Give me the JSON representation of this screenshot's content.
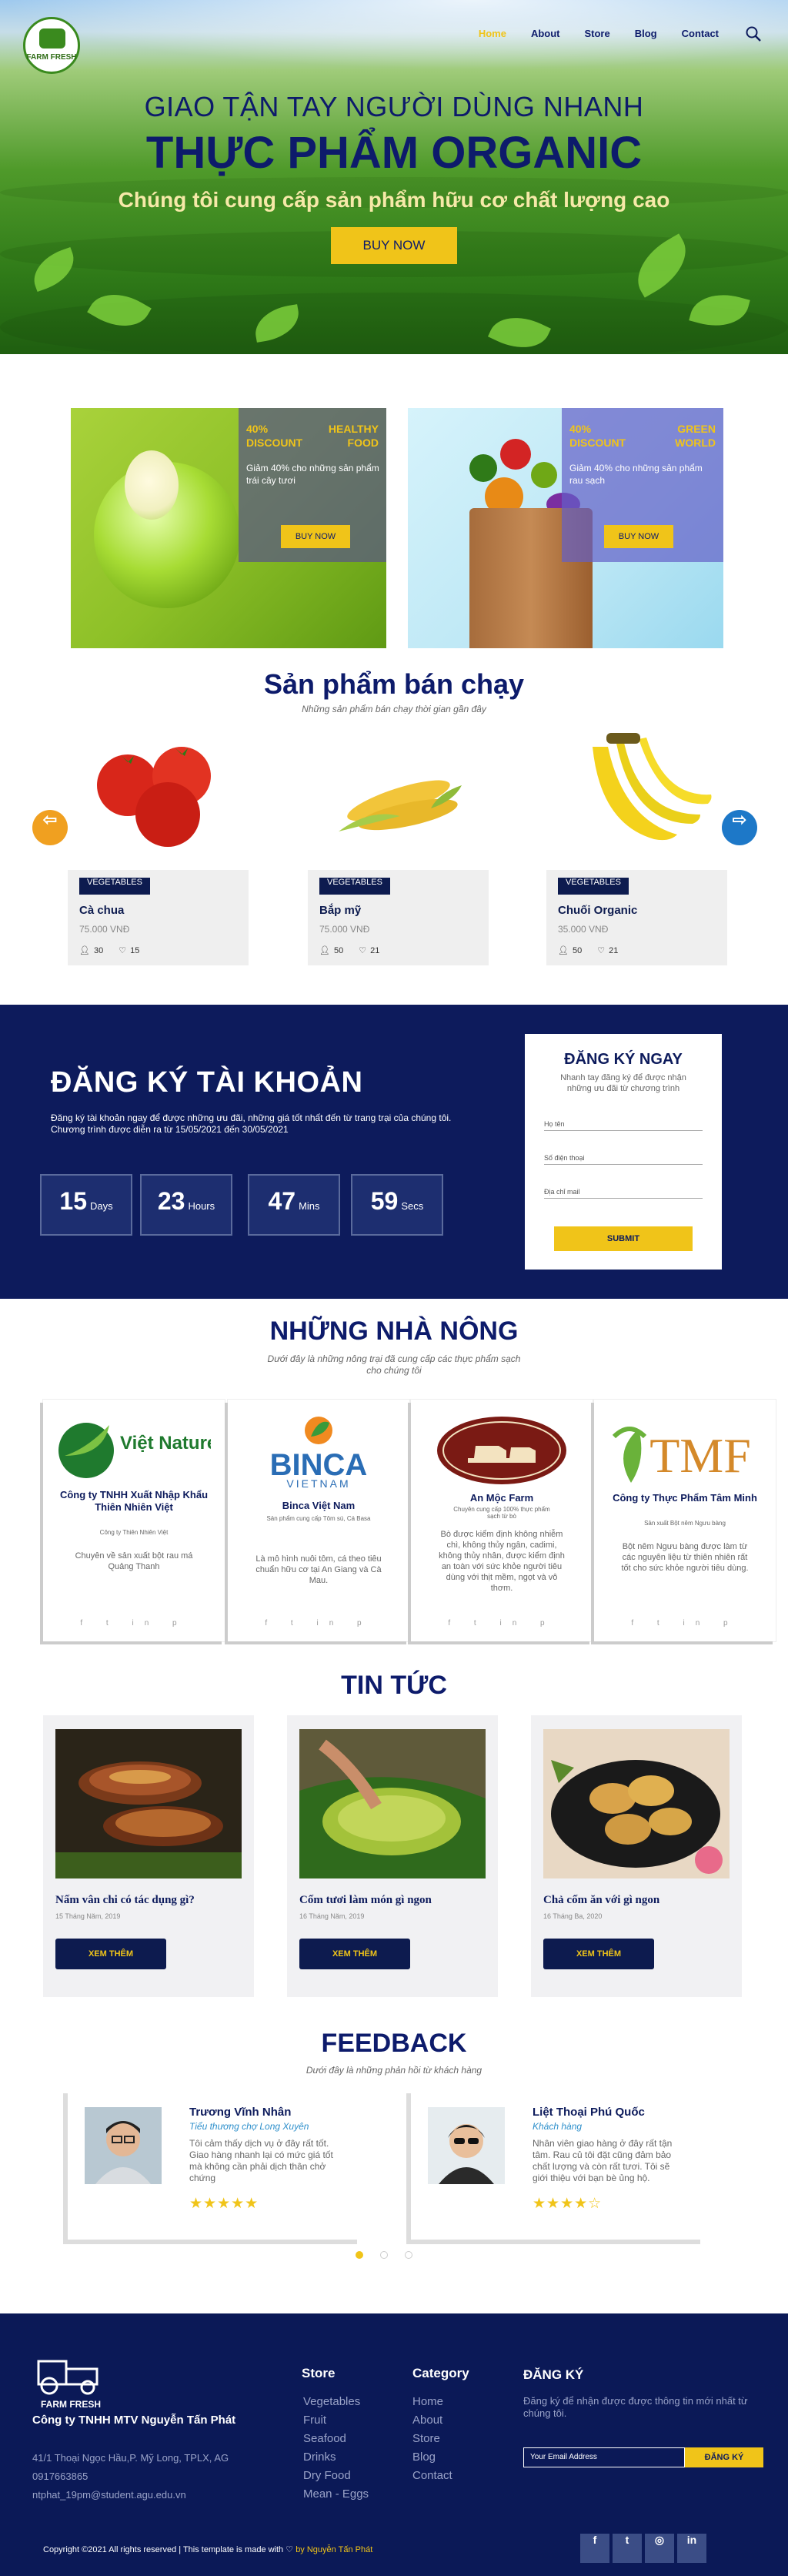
{
  "header": {
    "logo_text": "FARM FRESH",
    "nav": [
      "Home",
      "About",
      "Store",
      "Blog",
      "Contact"
    ],
    "search_icon": "search-icon"
  },
  "hero": {
    "line1": "GIAO TẬN TAY NGƯỜI DÙNG NHANH",
    "line2": "THỰC PHẨM ORGANIC",
    "line3": "Chúng tôi cung cấp sản phẩm hữu cơ chất lượng cao",
    "button": "BUY NOW"
  },
  "promos": [
    {
      "discount": "40% DISCOUNT",
      "label": "HEALTHY FOOD",
      "text": "Giảm 40% cho những sản phẩm trái cây tươi",
      "button": "BUY NOW"
    },
    {
      "discount": "40% DISCOUNT",
      "label": "GREEN WORLD",
      "text": "Giảm 40% cho những sản phẩm rau sạch",
      "button": "BUY NOW"
    }
  ],
  "bestseller": {
    "title": "Sản phẩm bán chạy",
    "subtitle": "Những sản phẩm bán chạy thời gian gần đây",
    "products": [
      {
        "tag": "VEGETABLES",
        "name": "Cà chua",
        "price": "75.000 VNĐ",
        "users": "30",
        "likes": "15"
      },
      {
        "tag": "VEGETABLES",
        "name": "Bắp mỹ",
        "price": "75.000 VNĐ",
        "users": "50",
        "likes": "21"
      },
      {
        "tag": "VEGETABLES",
        "name": "Chuối Organic",
        "price": "35.000 VNĐ",
        "users": "50",
        "likes": "21"
      }
    ]
  },
  "register": {
    "title": "ĐĂNG KÝ TÀI KHOẢN",
    "text1": "Đăng ký tài khoản ngay để được những ưu đãi, những giá tốt nhất đến từ trang trại của chúng tôi.",
    "text2": "Chương trình được diễn ra từ 15/05/2021 đến 30/05/2021",
    "countdown": [
      {
        "value": "15",
        "unit": "Days"
      },
      {
        "value": "23",
        "unit": "Hours"
      },
      {
        "value": "47",
        "unit": "Mins"
      },
      {
        "value": "59",
        "unit": "Secs"
      }
    ],
    "form": {
      "title": "ĐĂNG KÝ NGAY",
      "subtitle": "Nhanh tay đăng ký để được nhận những ưu đãi từ chương trình",
      "name_placeholder": "Họ tên",
      "phone_placeholder": "Số điện thoại",
      "email_placeholder": "Địa chỉ mail",
      "submit": "SUBMIT"
    }
  },
  "farmers": {
    "title": "NHỮNG NHÀ NÔNG",
    "subtitle": "Dưới đây là những nông trại đã cung cấp các thực phẩm sạch cho chúng tôi",
    "items": [
      {
        "logo": "Việt Nature",
        "name": "Công ty TNHH Xuất Nhập Khẩu Thiên Nhiên Việt",
        "sub": "Công ty Thiên Nhiên Việt",
        "desc": "Chuyên về sản xuất bột rau má Quảng Thanh"
      },
      {
        "logo": "BINCA",
        "logo2": "VIETNAM",
        "name": "Binca Việt Nam",
        "sub": "Sản phẩm cung cấp Tôm sú, Cá Basa",
        "desc": "Là mô hình nuôi tôm, cá theo tiêu chuẩn hữu cơ tại An Giang và Cà Mau."
      },
      {
        "logo": "",
        "name": "An Mộc Farm",
        "sub": "Chuyên cung cấp 100% thực phẩm sạch từ bò",
        "desc": "Bò được kiểm định không nhiễm chì, không thủy ngân, cadimi, không thủy nhân, được kiểm định an toàn với sức khỏe người tiêu dùng với thịt mềm, ngọt và vô thơm."
      },
      {
        "logo": "TMF",
        "name": "Công ty Thực Phẩm Tâm Minh",
        "sub": "Sản xuất Bột nêm Ngưu bàng",
        "desc": "Bột nêm Ngưu bàng được làm từ các nguyên liệu từ thiên nhiên rất tốt cho sức khỏe người tiêu dùng."
      }
    ]
  },
  "news": {
    "title": "TIN TỨC",
    "items": [
      {
        "title": "Nấm vân chi có tác dụng gì?",
        "date": "15 Tháng Năm, 2019",
        "button": "XEM THÊM"
      },
      {
        "title": "Cốm tươi làm món gì ngon",
        "date": "16 Tháng Năm, 2019",
        "button": "XEM THÊM"
      },
      {
        "title": "Chả cốm ăn với gì ngon",
        "date": "16 Tháng Ba, 2020",
        "button": "XEM THÊM"
      }
    ]
  },
  "feedback": {
    "title": "FEEDBACK",
    "subtitle": "Dưới đây là những phản hồi từ khách hàng",
    "items": [
      {
        "name": "Trương Vĩnh Nhân",
        "role": "Tiểu thương chợ Long Xuyên",
        "text": "Tôi cảm thấy dịch vụ ở đây rất tốt. Giao hàng nhanh lại có mức giá tốt mà không cần phải dịch thân chở chứng",
        "stars": "★★★★★",
        "rating": 5
      },
      {
        "name": "Liệt Thoại Phú Quốc",
        "role": "Khách hàng",
        "text": "Nhân viên giao hàng ở đây rất tận tâm. Rau củ tôi đặt cũng đảm bảo chất lượng và còn rất tươi. Tôi sẽ giới thiệu với bạn bè ủng hộ.",
        "stars": "★★★★☆",
        "rating": 4
      }
    ]
  },
  "footer": {
    "logo_text": "FARM FRESH",
    "company": "Công ty TNHH MTV Nguyễn Tấn Phát",
    "address": "41/1 Thoại Ngọc Hầu,P. Mỹ Long, TPLX, AG",
    "phone": "0917663865",
    "email": "ntphat_19pm@student.agu.edu.vn",
    "store_title": "Store",
    "store_items": [
      "Vegetables",
      "Fruit",
      "Seafood",
      "Drinks",
      "Dry Food",
      "Mean - Eggs"
    ],
    "category_title": "Category",
    "category_items": [
      "Home",
      "About",
      "Store",
      "Blog",
      "Contact"
    ],
    "signup_title": "ĐĂNG KÝ",
    "signup_text": "Đăng ký để nhận được được thông tin mới nhất từ chúng tôi.",
    "email_placeholder": "Your Email Address",
    "signup_button": "ĐĂNG KÝ",
    "copyright": "Copyright ©2021 All rights reserved | This template is made with",
    "author": "by Nguyễn Tấn Phát",
    "social": [
      "f",
      "t",
      "◎",
      "in"
    ]
  },
  "colors": {
    "navy": "#0d1b5c",
    "yellow": "#f0c419",
    "accent_blue": "#2d8fcb",
    "orange_arrow": "#f0a020"
  }
}
